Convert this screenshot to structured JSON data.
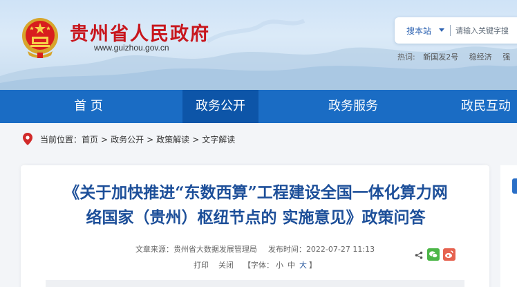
{
  "header": {
    "site_title": "贵州省人民政府",
    "site_url": "www.guizhou.gov.cn",
    "search": {
      "scope_label": "搜本站",
      "placeholder": "请输入关键字搜"
    },
    "hotwords": {
      "label": "热词:",
      "items": [
        "新国发2号",
        "稳经济",
        "强"
      ]
    }
  },
  "nav": {
    "items": [
      {
        "label": "首  页"
      },
      {
        "label": "政务公开"
      },
      {
        "label": "政务服务"
      },
      {
        "label": "政民互动"
      }
    ],
    "active_index": 1
  },
  "breadcrumb": {
    "prefix": "当前位置：",
    "items": [
      "首页",
      "政务公开",
      "政策解读",
      "文字解读"
    ],
    "separator": ">"
  },
  "article": {
    "title_line1": "《关于加快推进“东数西算”工程建设全国一体化算力网",
    "title_line2": "络国家（贵州）枢纽节点的 实施意见》政策问答",
    "source_label": "文章来源：",
    "source": "贵州省大数据发展管理局",
    "time_label": "发布时间：",
    "time": "2022-07-27 11:13",
    "print_label": "打印",
    "close_label": "关闭",
    "font_label": "【字体：",
    "font_sizes": [
      "小",
      "中",
      "大"
    ],
    "font_close": "】"
  },
  "colors": {
    "brand_red": "#c8161d",
    "nav_blue": "#1a6cc4",
    "nav_active": "#0d55a8",
    "title_blue": "#1d4f99"
  }
}
